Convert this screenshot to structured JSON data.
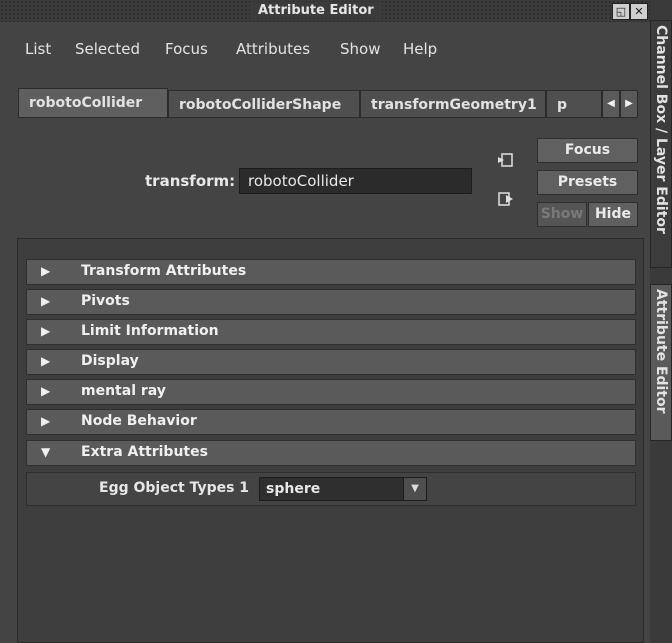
{
  "window": {
    "title": "Attribute Editor"
  },
  "titlebar_buttons": {
    "float": "◱",
    "close": "✕"
  },
  "menu": [
    "List",
    "Selected",
    "Focus",
    "Attributes",
    "Show",
    "Help"
  ],
  "tabs": [
    {
      "label": "robotoCollider",
      "active": true
    },
    {
      "label": "robotoColliderShape",
      "active": false
    },
    {
      "label": "transformGeometry1",
      "active": false
    },
    {
      "label": "p",
      "active": false
    }
  ],
  "tab_scroll": {
    "left": "◀",
    "right": "▶"
  },
  "node": {
    "type_label": "transform:",
    "name": "robotoCollider"
  },
  "buttons": {
    "focus": "Focus",
    "presets": "Presets",
    "show": "Show",
    "hide": "Hide"
  },
  "sections": [
    {
      "label": "Transform Attributes",
      "expanded": false
    },
    {
      "label": "Pivots",
      "expanded": false
    },
    {
      "label": "Limit Information",
      "expanded": false
    },
    {
      "label": "Display",
      "expanded": false
    },
    {
      "label": "mental ray",
      "expanded": false
    },
    {
      "label": "Node Behavior",
      "expanded": false
    },
    {
      "label": "Extra Attributes",
      "expanded": true
    }
  ],
  "extra_attributes": [
    {
      "label": "Egg Object Types 1",
      "value": "sphere"
    }
  ],
  "side_tabs": [
    "Channel Box / Layer Editor",
    "Attribute Editor"
  ],
  "icons": {
    "collapsed": "▶",
    "expanded": "▼",
    "dropdown": "▼",
    "copy_tab": "copy-tab-icon",
    "select_node": "select-node-icon"
  }
}
